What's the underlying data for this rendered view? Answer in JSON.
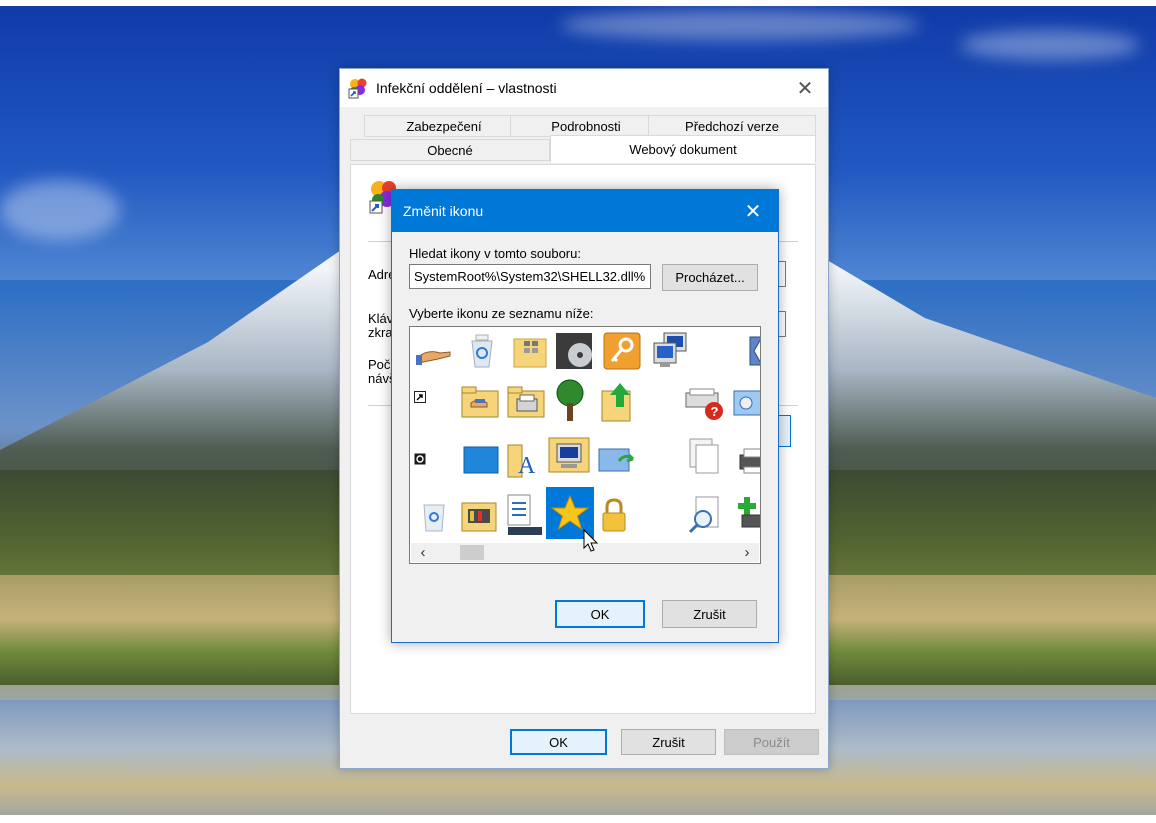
{
  "properties_window": {
    "title": "Infekční oddělení – vlastnosti",
    "tabs_row1": [
      "Zabezpečení",
      "Podrobnosti",
      "Předchozí verze"
    ],
    "tabs_row2": [
      "Obecné",
      "Webový dokument"
    ],
    "active_tab": "Webový dokument",
    "labels": {
      "address": "Adre",
      "shortcut_line1": "Kláv",
      "shortcut_line2": "zkra",
      "visits_line1": "Poč",
      "visits_line2": "návš"
    },
    "buttons": {
      "ok": "OK",
      "cancel": "Zrušit",
      "apply": "Použít"
    }
  },
  "change_icon_dialog": {
    "title": "Změnit ikonu",
    "search_label": "Hledat ikony v tomto souboru:",
    "path_value": "%SystemRoot%\\System32\\SHELL32.dll",
    "browse_label": "Procházet...",
    "select_label": "Vyberte ikonu ze seznamu níže:",
    "selected_icon": "star-icon",
    "buttons": {
      "ok": "OK",
      "cancel": "Zrušit"
    }
  },
  "icons": {
    "row1": [
      "hand-share-icon",
      "recycle-bin-full-icon",
      "folder-grid-icon",
      "media-disc-icon",
      "key-icon",
      "network-computer-icon",
      "hourglass-icon"
    ],
    "row2": [
      "shortcut-arrow-icon",
      "shared-folder-icon",
      "printer-folder-icon",
      "tree-icon",
      "upload-folder-icon",
      "help-printer-icon",
      "display-settings-icon"
    ],
    "row3": [
      "backup-badge-icon",
      "blue-window-icon",
      "fonts-folder-icon",
      "computer-folder-icon",
      "sync-window-icon",
      "copy-pages-icon",
      "printer-icon"
    ],
    "row4": [
      "recycle-bin-empty-icon",
      "control-panel-folder-icon",
      "task-list-icon",
      "star-icon",
      "padlock-icon",
      "search-document-icon",
      "add-printer-icon"
    ]
  },
  "colors": {
    "accent": "#0078d7",
    "titlebar_active": "#0078d7",
    "dialog_bg": "#f0f0f0"
  }
}
